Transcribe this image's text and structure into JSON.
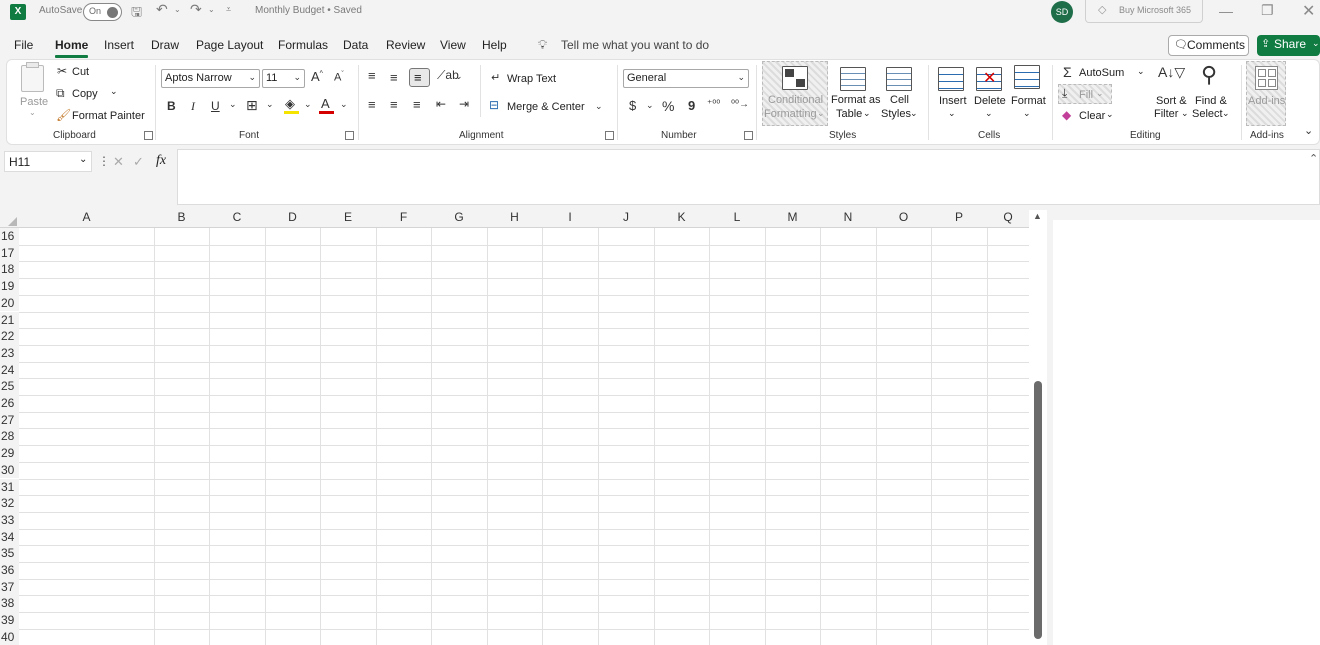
{
  "titlebar": {
    "autosave_label": "AutoSave",
    "autosave_state": "On",
    "file_title": "Monthly Budget • Saved",
    "avatar_initials": "SD",
    "buy_label": "Buy Microsoft 365"
  },
  "menu": {
    "tabs": [
      "File",
      "Home",
      "Insert",
      "Draw",
      "Page Layout",
      "Formulas",
      "Data",
      "Review",
      "View",
      "Help"
    ],
    "active": "Home",
    "tell_me": "Tell me what you want to do",
    "comments": "Comments",
    "share": "Share"
  },
  "ribbon": {
    "clipboard": {
      "paste": "Paste",
      "cut": "Cut",
      "copy": "Copy",
      "format_painter": "Format Painter",
      "label": "Clipboard"
    },
    "font": {
      "name": "Aptos Narrow",
      "size": "11",
      "bold": "B",
      "italic": "I",
      "underline": "U",
      "font_color_glyph": "A",
      "label": "Font"
    },
    "alignment": {
      "wrap_text": "Wrap Text",
      "merge_center": "Merge & Center",
      "label": "Alignment"
    },
    "number": {
      "format": "General",
      "currency": "$",
      "percent": "%",
      "comma": "9",
      "label": "Number"
    },
    "styles": {
      "conditional": "Conditional",
      "formatting": "Formatting",
      "format_as": "Format as",
      "table": "Table",
      "cell": "Cell",
      "styles_word": "Styles",
      "label": "Styles"
    },
    "cells": {
      "insert": "Insert",
      "delete": "Delete",
      "format": "Format",
      "label": "Cells"
    },
    "editing": {
      "autosum": "AutoSum",
      "fill": "Fill",
      "clear": "Clear",
      "sort": "Sort &",
      "filter": "Filter",
      "find": "Find &",
      "select": "Select",
      "label": "Editing"
    },
    "addins": {
      "button": "Add-ins",
      "label": "Add-ins"
    }
  },
  "formula_bar": {
    "name_box": "H11",
    "fx": "fx",
    "value": ""
  },
  "sheet": {
    "columns": [
      "A",
      "B",
      "C",
      "D",
      "E",
      "F",
      "G",
      "H",
      "I",
      "J",
      "K",
      "L",
      "M",
      "N",
      "O",
      "P",
      "Q"
    ],
    "rows": [
      "16",
      "17",
      "18",
      "19",
      "20",
      "21",
      "22",
      "23",
      "24",
      "25",
      "26",
      "27",
      "28",
      "29",
      "30",
      "31",
      "32",
      "33",
      "34",
      "35",
      "36",
      "37",
      "38",
      "39",
      "40"
    ]
  }
}
